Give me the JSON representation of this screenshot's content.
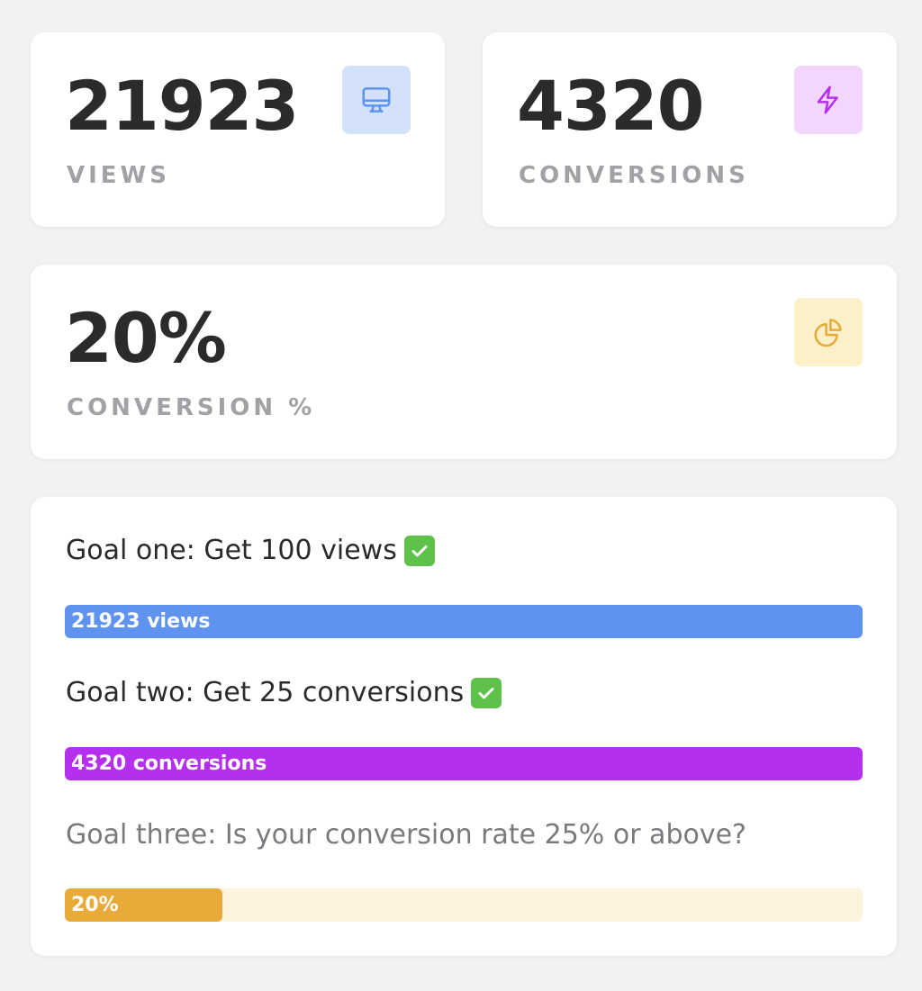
{
  "stats": {
    "views": {
      "value": "21923",
      "label": "VIEWS",
      "icon": "monitor-icon",
      "accent": "#5f93ef"
    },
    "conversions": {
      "value": "4320",
      "label": "CONVERSIONS",
      "icon": "lightning-icon",
      "accent": "#b52fee"
    },
    "rate": {
      "value": "20%",
      "label": "CONVERSION %",
      "icon": "pie-chart-icon",
      "accent": "#e8aa38"
    }
  },
  "goals": [
    {
      "title": "Goal one: Get 100 views",
      "complete": true,
      "bar_label": "21923 views",
      "progress": 1.0,
      "bar_color": "#5f93ef"
    },
    {
      "title": "Goal two: Get 25 conversions",
      "complete": true,
      "bar_label": "4320 conversions",
      "progress": 1.0,
      "bar_color": "#b52fee"
    },
    {
      "title": "Goal three: Is your conversion rate 25% or above?",
      "complete": false,
      "bar_label": "20%",
      "progress": 0.197,
      "bar_color": "#e8aa38"
    }
  ],
  "colors": {
    "background": "#f2f2f3",
    "text": "#2b2b2e",
    "muted": "#a2a2a6",
    "check_green": "#5ec24a"
  }
}
